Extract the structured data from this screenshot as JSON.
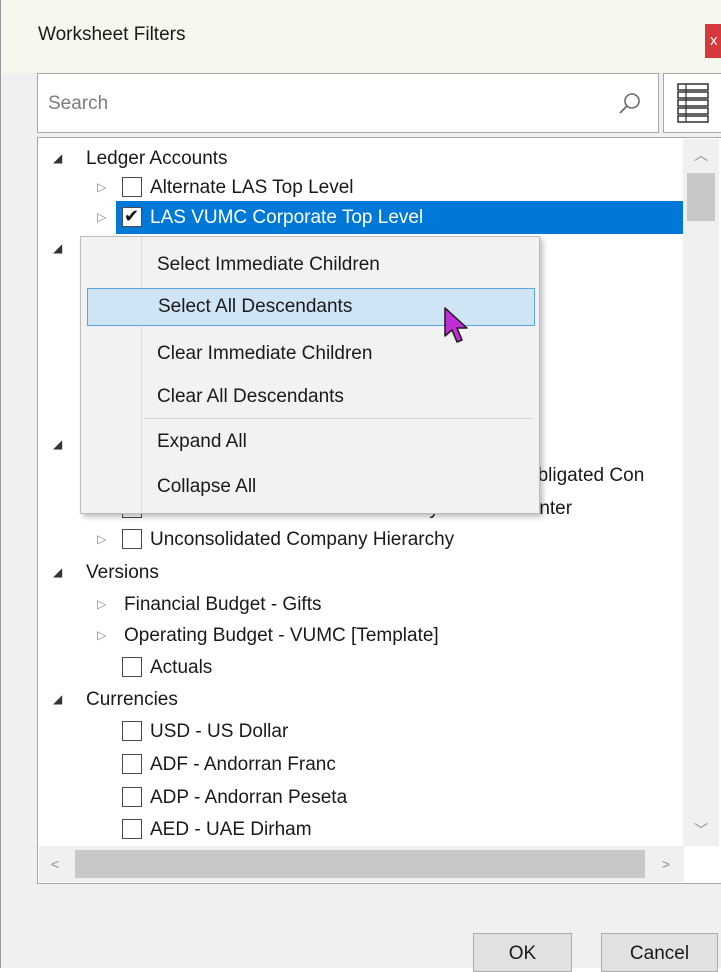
{
  "dialog": {
    "title": "Worksheet Filters",
    "close_glyph": "x"
  },
  "search": {
    "placeholder": "Search"
  },
  "tree": {
    "rows": [
      {
        "label": "Ledger Accounts"
      },
      {
        "label": "Alternate LAS Top Level"
      },
      {
        "label": "LAS VUMC Corporate Top Level"
      },
      {
        "label": "obligated Con"
      },
      {
        "label": "Consolidated Vanderbilt University Medical Center"
      },
      {
        "label": "Unconsolidated Company Hierarchy"
      },
      {
        "label": "Versions"
      },
      {
        "label": "Financial Budget - Gifts"
      },
      {
        "label": "Operating Budget - VUMC [Template]"
      },
      {
        "label": "Actuals"
      },
      {
        "label": "Currencies"
      },
      {
        "label": "USD - US Dollar"
      },
      {
        "label": "ADF - Andorran Franc"
      },
      {
        "label": "ADP - Andorran Peseta"
      },
      {
        "label": "AED - UAE Dirham"
      }
    ]
  },
  "context_menu": {
    "items": [
      {
        "label": "Select Immediate Children"
      },
      {
        "label": "Select All Descendants"
      },
      {
        "label": "Clear Immediate Children"
      },
      {
        "label": "Clear All Descendants"
      },
      {
        "label": "Expand All"
      },
      {
        "label": "Collapse All"
      }
    ]
  },
  "buttons": {
    "ok": "OK",
    "cancel": "Cancel"
  },
  "colors": {
    "selection": "#0078d7",
    "menu_hover": "#cfe5f5",
    "menu_hover_border": "#5aa7de",
    "close_button": "#d6393b",
    "cursor": "#c12dd6"
  }
}
